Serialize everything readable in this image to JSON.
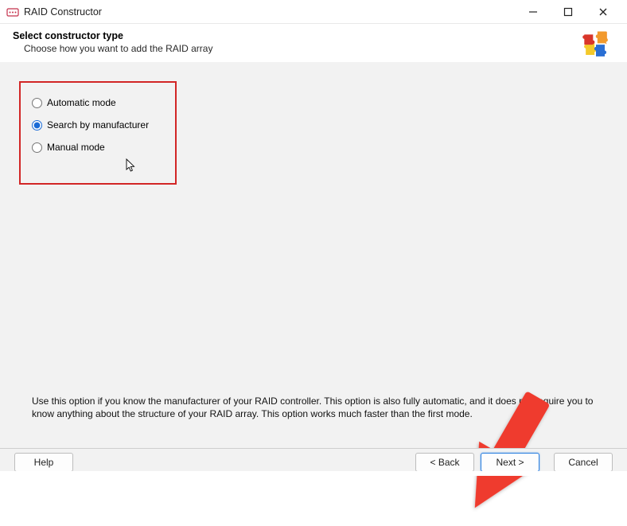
{
  "window": {
    "title": "RAID Constructor"
  },
  "header": {
    "title": "Select constructor type",
    "subtitle": "Choose how you want to add the RAID array"
  },
  "options": {
    "opt1": {
      "label": "Automatic mode",
      "checked": false
    },
    "opt2": {
      "label": "Search by manufacturer",
      "checked": true
    },
    "opt3": {
      "label": "Manual mode",
      "checked": false
    }
  },
  "description": "Use this option if you know the manufacturer of your RAID controller. This option is also fully automatic, and it does not require you to know anything about the structure of your RAID array. This option works much faster than the first mode.",
  "footer": {
    "help": "Help",
    "back": "< Back",
    "next": "Next >",
    "cancel": "Cancel"
  }
}
